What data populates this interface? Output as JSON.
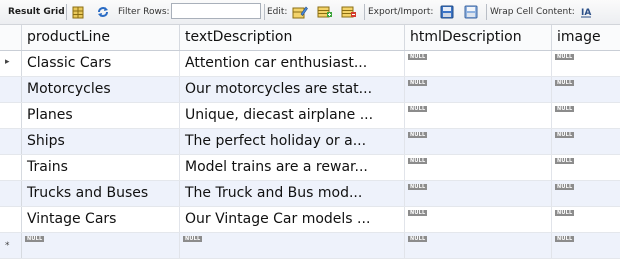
{
  "toolbar": {
    "result_grid_label": "Result Grid",
    "filter_rows_label": "Filter Rows:",
    "filter_value": "",
    "edit_label": "Edit:",
    "export_import_label": "Export/Import:",
    "wrap_cell_label": "Wrap Cell Content:"
  },
  "columns": [
    "productLine",
    "textDescription",
    "htmlDescription",
    "image"
  ],
  "null_label": "NULL",
  "rows": [
    {
      "productLine": "Classic Cars",
      "textDescription": "Attention car enthusiast...",
      "htmlDescription": "NULL",
      "image": "NULL"
    },
    {
      "productLine": "Motorcycles",
      "textDescription": "Our motorcycles are stat...",
      "htmlDescription": "NULL",
      "image": "NULL"
    },
    {
      "productLine": "Planes",
      "textDescription": "Unique, diecast airplane ...",
      "htmlDescription": "NULL",
      "image": "NULL"
    },
    {
      "productLine": "Ships",
      "textDescription": "The perfect holiday or a...",
      "htmlDescription": "NULL",
      "image": "NULL"
    },
    {
      "productLine": "Trains",
      "textDescription": "Model trains are a rewar...",
      "htmlDescription": "NULL",
      "image": "NULL"
    },
    {
      "productLine": "Trucks and Buses",
      "textDescription": "The Truck and Bus mod...",
      "htmlDescription": "NULL",
      "image": "NULL"
    },
    {
      "productLine": "Vintage Cars",
      "textDescription": "Our Vintage Car models ...",
      "htmlDescription": "NULL",
      "image": "NULL"
    }
  ],
  "new_row": {
    "productLine": "NULL",
    "textDescription": "NULL",
    "htmlDescription": "NULL",
    "image": "NULL"
  },
  "current_row_marker": "▸",
  "new_row_marker": "*",
  "icons": [
    "grid-icon",
    "refresh-icon",
    "edit-row-icon",
    "add-row-icon",
    "delete-row-icon",
    "export-icon",
    "import-icon",
    "wrap-icon"
  ]
}
